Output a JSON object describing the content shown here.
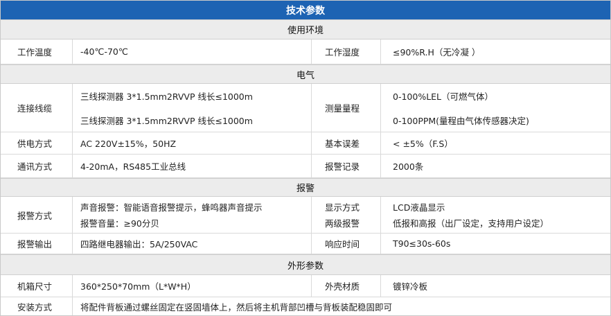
{
  "title": "技术参数",
  "sections": {
    "env": "使用环境",
    "electrical": "电气",
    "alarm": "报警",
    "appearance": "外形参数"
  },
  "rows": {
    "work_temp": {
      "label": "工作温度",
      "value": "-40℃-70℃",
      "label2": "工作湿度",
      "value2": "≤90%R.H（无冷凝 ）"
    },
    "cable": {
      "label": "连接线缆",
      "value_line1": "三线探测器 3*1.5mm2RVVP 线长≤1000m",
      "value_line2": "三线探测器 3*1.5mm2RVVP 线长≤1000m",
      "label2": "测量量程",
      "value2_line1": "0-100%LEL（可燃气体）",
      "value2_line2": "0-100PPM(量程由气体传感器决定)"
    },
    "power": {
      "label": "供电方式",
      "value": "AC 220V±15%，50HZ",
      "label2": "基本误差",
      "value2": "< ±5%（F.S）"
    },
    "comm": {
      "label": "通讯方式",
      "value": "4-20mA，RS485工业总线",
      "label2": "报警记录",
      "value2": "2000条"
    },
    "alarm_mode": {
      "label": "报警方式",
      "value_line1": "声音报警：智能语音报警提示，蜂鸣器声音提示",
      "value_line2": "报警音量：≥90分贝",
      "label2_line1": "显示方式",
      "label2_line2": "两级报警",
      "value2_line1": "LCD液晶显示",
      "value2_line2": "低报和高报（出厂设定，支持用户设定）"
    },
    "alarm_output": {
      "label": "报警输出",
      "value": "四路继电器输出：5A/250VAC",
      "label2": "响应时间",
      "value2": "T90≤30s-60s"
    },
    "size": {
      "label": "机箱尺寸",
      "value": "360*250*70mm（L*W*H）",
      "label2": "外壳材质",
      "value2": "镀锌冷板"
    },
    "install": {
      "label": "安装方式",
      "value": "将配件背板通过螺丝固定在竖固墙体上，然后将主机背部凹槽与背板装配稳固即可"
    }
  }
}
